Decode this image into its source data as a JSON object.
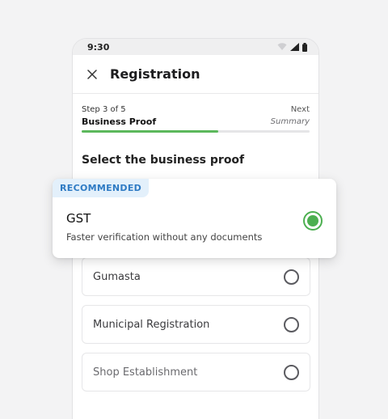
{
  "status_bar": {
    "time": "9:30"
  },
  "header": {
    "title": "Registration"
  },
  "stepper": {
    "step_count": "Step 3 of 5",
    "current_step": "Business Proof",
    "next_label": "Next",
    "next_step": "Summary",
    "progress": 0.6
  },
  "section_title": "Select the business proof",
  "recommended": {
    "badge": "RECOMMENDED",
    "title": "GST",
    "description": "Faster verification without any documents",
    "selected": true
  },
  "options": [
    {
      "label": "Gumasta"
    },
    {
      "label": "Municipal Registration"
    },
    {
      "label": "Shop Establishment"
    }
  ],
  "colors": {
    "accent": "#4caf50",
    "badge_bg": "#e3f0fb",
    "badge_text": "#2f7bc4"
  }
}
